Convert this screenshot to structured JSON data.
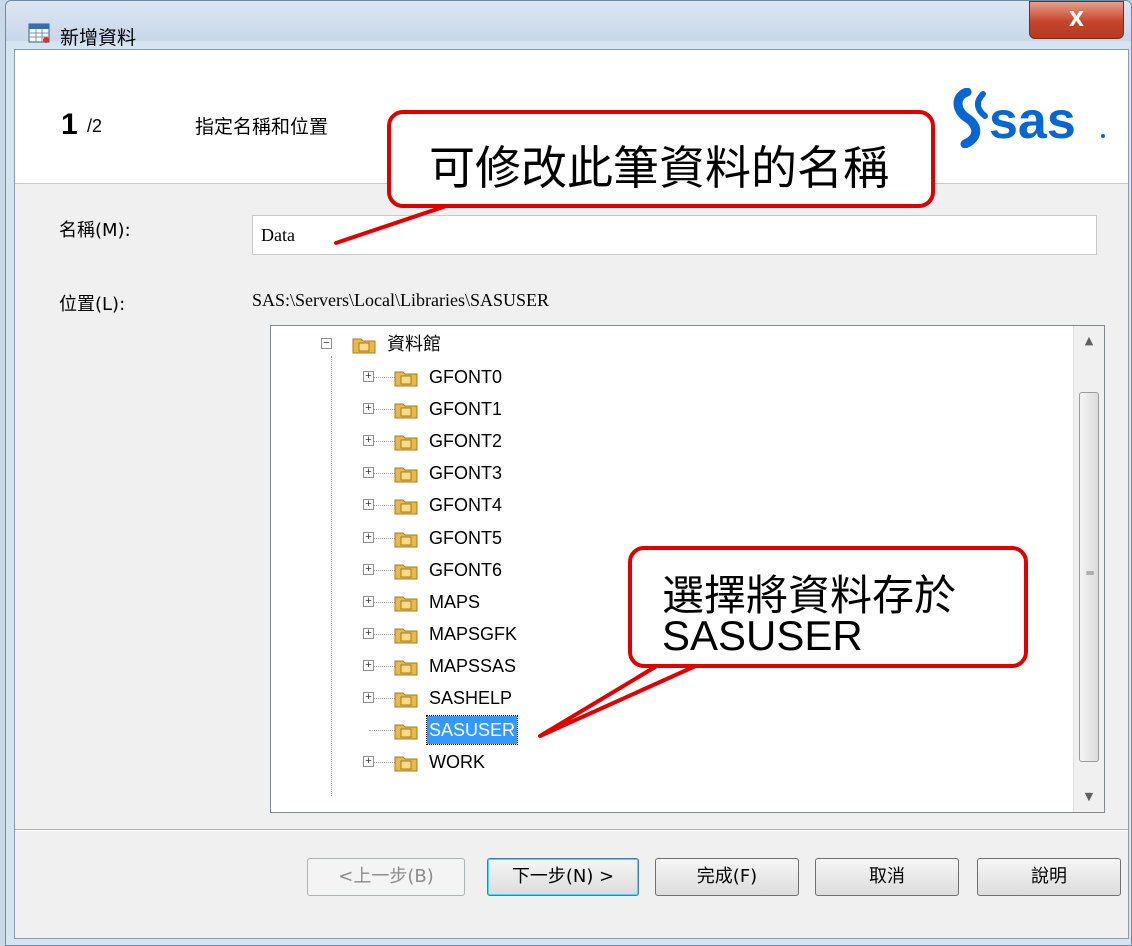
{
  "window": {
    "title": "新增資料",
    "close_glyph": "X"
  },
  "header": {
    "step_current": "1",
    "step_total": "/2",
    "step_title": "指定名稱和位置",
    "logo_text": "sas"
  },
  "form": {
    "name_label": "名稱(M):",
    "name_value": "Data",
    "location_label": "位置(L):",
    "location_path": "SAS:\\Servers\\Local\\Libraries\\SASUSER"
  },
  "tree": {
    "root": {
      "label": "資料館",
      "expander": "−"
    },
    "items": [
      {
        "label": "GFONT0",
        "expander": "+",
        "selected": false
      },
      {
        "label": "GFONT1",
        "expander": "+",
        "selected": false
      },
      {
        "label": "GFONT2",
        "expander": "+",
        "selected": false
      },
      {
        "label": "GFONT3",
        "expander": "+",
        "selected": false
      },
      {
        "label": "GFONT4",
        "expander": "+",
        "selected": false
      },
      {
        "label": "GFONT5",
        "expander": "+",
        "selected": false
      },
      {
        "label": "GFONT6",
        "expander": "+",
        "selected": false
      },
      {
        "label": "MAPS",
        "expander": "+",
        "selected": false
      },
      {
        "label": "MAPSGFK",
        "expander": "+",
        "selected": false
      },
      {
        "label": "MAPSSAS",
        "expander": "+",
        "selected": false
      },
      {
        "label": "SASHELP",
        "expander": "+",
        "selected": false
      },
      {
        "label": "SASUSER",
        "expander": "",
        "selected": true
      },
      {
        "label": "WORK",
        "expander": "+",
        "selected": false
      }
    ]
  },
  "buttons": {
    "back": "<上一步(B)",
    "next": "下一步(N) >",
    "finish": "完成(F)",
    "cancel": "取消",
    "help": "說明"
  },
  "callouts": {
    "name_note": "可修改此筆資料的名稱",
    "location_note_line1": "選擇將資料存於",
    "location_note_line2": "SASUSER"
  },
  "colors": {
    "callout_border": "#e00000",
    "selection": "#3399ff",
    "logo_blue": "#0766d1"
  }
}
